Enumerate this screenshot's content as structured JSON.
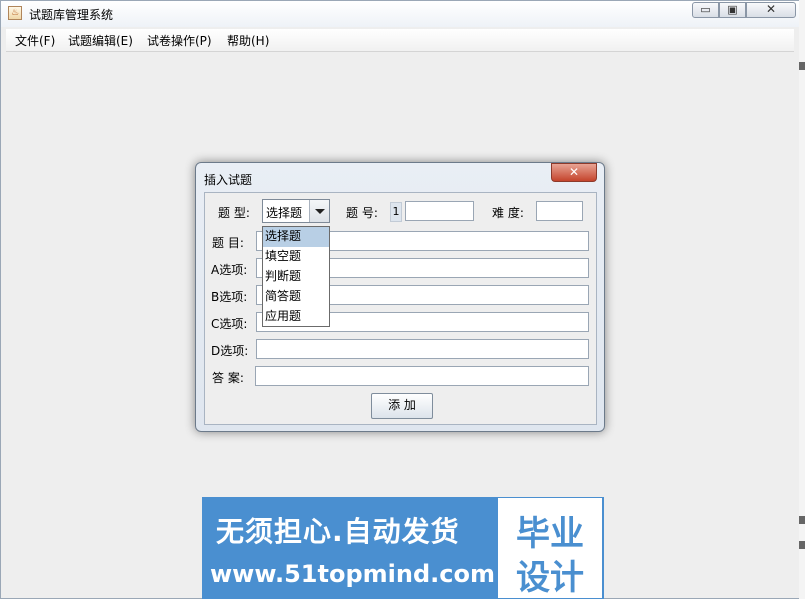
{
  "window": {
    "title": "试题库管理系统",
    "app_icon_glyph": "♨"
  },
  "window_controls": {
    "minimize": "▭",
    "maximize": "▣",
    "close": "✕"
  },
  "menu": [
    {
      "label": "文件(F)"
    },
    {
      "label": "试题编辑(E)"
    },
    {
      "label": "试卷操作(P)"
    },
    {
      "label": "帮助(H)"
    }
  ],
  "dialog": {
    "title": "插入试题",
    "close_glyph": "✕",
    "type_label": "题  型:",
    "type_value": "选择题",
    "type_options": [
      "选择题",
      "填空题",
      "判断题",
      "简答题",
      "应用题"
    ],
    "number_label": "题  号:",
    "number_value": "1",
    "difficulty_label": "难  度:",
    "question_label": "题  目:",
    "option_a_label": "A选项:",
    "option_b_label": "B选项:",
    "option_c_label": "C选项:",
    "option_d_label": "D选项:",
    "answer_label": "答  案:",
    "add_button": "添 加"
  },
  "watermark": {
    "line1": "无须担心.自动发货",
    "line2": "www.51topmind.com",
    "box_line1": "毕业",
    "box_line2": "设计"
  },
  "icons": {
    "dropdown_arrow": "chevron-down-icon",
    "app_icon": "java-cup-icon"
  }
}
